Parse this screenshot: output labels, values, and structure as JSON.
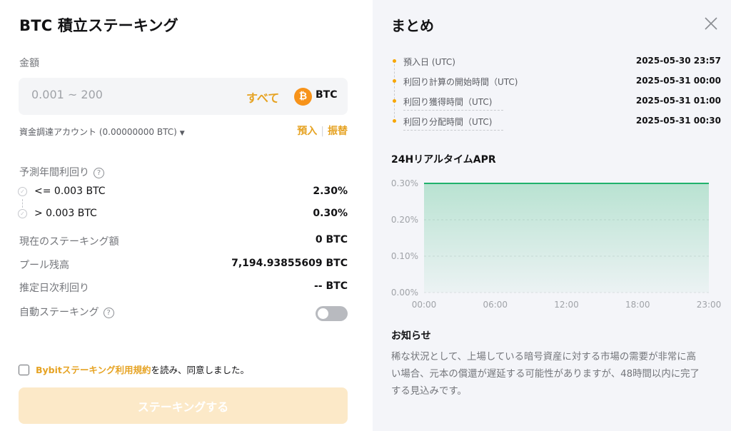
{
  "left": {
    "title": "BTC 積立ステーキング",
    "amount_label": "金額",
    "amount_placeholder": "0.001 ~ 200",
    "all_label": "すべて",
    "coin_symbol": "₿",
    "coin_name": "BTC",
    "account_label": "資金調達アカウント (0.00000000 BTC)",
    "deposit_label": "預入",
    "transfer_label": "振替",
    "apr_title": "予測年間利回り",
    "tiers": [
      {
        "label": "<= 0.003 BTC",
        "value": "2.30%"
      },
      {
        "label": "> 0.003 BTC",
        "value": "0.30%"
      }
    ],
    "current_stake_label": "現在のステーキング額",
    "current_stake_value": "0 BTC",
    "pool_label": "プール残高",
    "pool_value": "7,194.93855609 BTC",
    "daily_label": "推定日次利回り",
    "daily_value": "-- BTC",
    "auto_label": "自動ステーキング",
    "auto_enabled": false,
    "agree_link": "Bybitステーキング利用規約",
    "agree_rest": "を読み、同意しました。",
    "stake_button": "ステーキングする"
  },
  "summary": {
    "title": "まとめ",
    "timeline": [
      {
        "label": "預入日 (UTC)",
        "value": "2025-05-30 23:57"
      },
      {
        "label": "利回り計算の開始時間（UTC)",
        "value": "2025-05-31 00:00"
      },
      {
        "label": "利回り獲得時間（UTC)",
        "value": "2025-05-31 01:00"
      },
      {
        "label": "利回り分配時間（UTC)",
        "value": "2025-05-31 00:30"
      }
    ],
    "chart_title": "24HリアルタイムAPR",
    "notice_title": "お知らせ",
    "notice_body": "稀な状況として、上場している暗号資産に対する市場の需要が非常に高い場合、元本の償還が遅延する可能性がありますが、48時間以内に完了する見込みです。"
  },
  "colors": {
    "accent": "#e6a323",
    "chart_line": "#20b26c"
  },
  "chart_data": {
    "type": "area",
    "x": [
      "00:00",
      "06:00",
      "12:00",
      "18:00",
      "23:00"
    ],
    "y_ticks": [
      "0.00%",
      "0.10%",
      "0.20%",
      "0.30%"
    ],
    "ylim": [
      0,
      0.3
    ],
    "series": [
      {
        "values": [
          0.3,
          0.3,
          0.3,
          0.3,
          0.3
        ]
      }
    ],
    "grid": true
  }
}
